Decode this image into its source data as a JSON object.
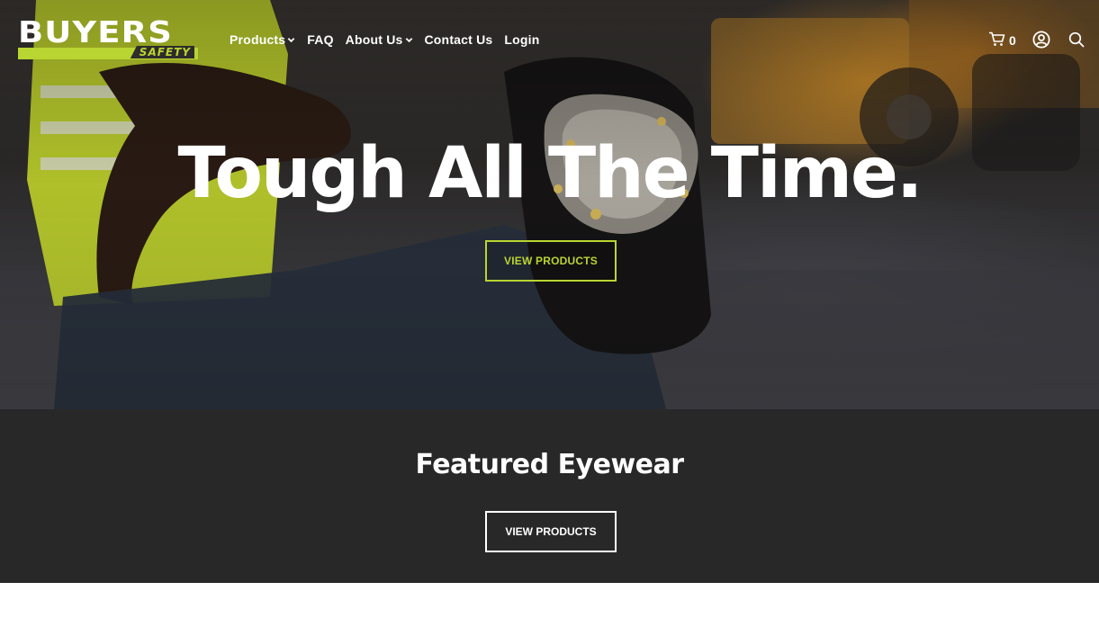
{
  "header": {
    "logo": {
      "word": "BUYERS",
      "sub": "SAFETY"
    },
    "nav": [
      {
        "label": "Products",
        "has_dropdown": true
      },
      {
        "label": "FAQ",
        "has_dropdown": false
      },
      {
        "label": "About Us",
        "has_dropdown": true
      },
      {
        "label": "Contact Us",
        "has_dropdown": false
      },
      {
        "label": "Login",
        "has_dropdown": false
      }
    ],
    "cart_count": "0",
    "icons": [
      "cart-icon",
      "account-icon",
      "search-icon"
    ]
  },
  "hero": {
    "title": "Tough All The Time.",
    "button_label": "VIEW PRODUCTS"
  },
  "featured": {
    "title": "Featured Eyewear",
    "button_label": "VIEW PRODUCTS"
  },
  "colors": {
    "accent": "#b9d531",
    "dark_band": "#282828",
    "text": "#ffffff"
  }
}
